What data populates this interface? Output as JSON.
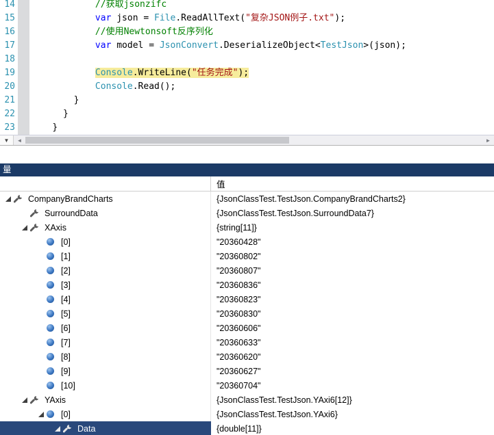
{
  "editor": {
    "lines": [
      {
        "num": "14",
        "indent": 12,
        "highlight": false,
        "tokens": [
          [
            "comment",
            "//获取jsonzifc"
          ]
        ]
      },
      {
        "num": "15",
        "indent": 12,
        "highlight": false,
        "tokens": [
          [
            "kw",
            "var"
          ],
          [
            "plain",
            " json = "
          ],
          [
            "type",
            "File"
          ],
          [
            "plain",
            ".ReadAllText("
          ],
          [
            "str",
            "\"复杂JSON例子.txt\""
          ],
          [
            "plain",
            ");"
          ]
        ]
      },
      {
        "num": "16",
        "indent": 12,
        "highlight": false,
        "tokens": [
          [
            "comment",
            "//使用Newtonsoft反序列化"
          ]
        ]
      },
      {
        "num": "17",
        "indent": 12,
        "highlight": false,
        "tokens": [
          [
            "kw",
            "var"
          ],
          [
            "plain",
            " model = "
          ],
          [
            "type",
            "JsonConvert"
          ],
          [
            "plain",
            ".DeserializeObject<"
          ],
          [
            "type",
            "TestJson"
          ],
          [
            "plain",
            ">(json);"
          ]
        ]
      },
      {
        "num": "18",
        "indent": 0,
        "highlight": false,
        "tokens": []
      },
      {
        "num": "19",
        "indent": 12,
        "highlight": true,
        "tokens": [
          [
            "type",
            "Console"
          ],
          [
            "plain",
            ".WriteLine("
          ],
          [
            "str",
            "\"任务完成\""
          ],
          [
            "plain",
            ");"
          ]
        ]
      },
      {
        "num": "20",
        "indent": 12,
        "highlight": false,
        "tokens": [
          [
            "type",
            "Console"
          ],
          [
            "plain",
            ".Read();"
          ]
        ]
      },
      {
        "num": "21",
        "indent": 8,
        "highlight": false,
        "tokens": [
          [
            "plain",
            "}"
          ]
        ]
      },
      {
        "num": "22",
        "indent": 6,
        "highlight": false,
        "tokens": [
          [
            "plain",
            "}"
          ]
        ]
      },
      {
        "num": "23",
        "indent": 4,
        "highlight": false,
        "tokens": [
          [
            "plain",
            "}"
          ]
        ]
      }
    ]
  },
  "scrollbar": {
    "dropdown_icon": "▼",
    "left_arrow": "◄",
    "right_arrow": "►"
  },
  "icons": {
    "property": "wrench-icon",
    "field": "blue-sphere-field-icon",
    "expanded": "triangle-expanded-icon",
    "collapsed": "triangle-collapsed-icon"
  },
  "locals_panel": {
    "title": "量",
    "columns": {
      "name": "",
      "value": "值"
    },
    "rows": [
      {
        "level": 0,
        "expander": "expanded",
        "icon": "property",
        "name": "CompanyBrandCharts",
        "value": "{JsonClassTest.TestJson.CompanyBrandCharts2}",
        "selected": false
      },
      {
        "level": 1,
        "expander": "none",
        "icon": "property",
        "name": "SurroundData",
        "value": "{JsonClassTest.TestJson.SurroundData7}",
        "selected": false
      },
      {
        "level": 1,
        "expander": "expanded",
        "icon": "property",
        "name": "XAxis",
        "value": "{string[11]}",
        "selected": false
      },
      {
        "level": 2,
        "expander": "none",
        "icon": "field",
        "name": "[0]",
        "value": "\"20360428\"",
        "selected": false
      },
      {
        "level": 2,
        "expander": "none",
        "icon": "field",
        "name": "[1]",
        "value": "\"20360802\"",
        "selected": false
      },
      {
        "level": 2,
        "expander": "none",
        "icon": "field",
        "name": "[2]",
        "value": "\"20360807\"",
        "selected": false
      },
      {
        "level": 2,
        "expander": "none",
        "icon": "field",
        "name": "[3]",
        "value": "\"20360836\"",
        "selected": false
      },
      {
        "level": 2,
        "expander": "none",
        "icon": "field",
        "name": "[4]",
        "value": "\"20360823\"",
        "selected": false
      },
      {
        "level": 2,
        "expander": "none",
        "icon": "field",
        "name": "[5]",
        "value": "\"20360830\"",
        "selected": false
      },
      {
        "level": 2,
        "expander": "none",
        "icon": "field",
        "name": "[6]",
        "value": "\"20360606\"",
        "selected": false
      },
      {
        "level": 2,
        "expander": "none",
        "icon": "field",
        "name": "[7]",
        "value": "\"20360633\"",
        "selected": false
      },
      {
        "level": 2,
        "expander": "none",
        "icon": "field",
        "name": "[8]",
        "value": "\"20360620\"",
        "selected": false
      },
      {
        "level": 2,
        "expander": "none",
        "icon": "field",
        "name": "[9]",
        "value": "\"20360627\"",
        "selected": false
      },
      {
        "level": 2,
        "expander": "none",
        "icon": "field",
        "name": "[10]",
        "value": "\"20360704\"",
        "selected": false
      },
      {
        "level": 1,
        "expander": "expanded",
        "icon": "property",
        "name": "YAxis",
        "value": "{JsonClassTest.TestJson.YAxi6[12]}",
        "selected": false
      },
      {
        "level": 2,
        "expander": "expanded",
        "icon": "field",
        "name": "[0]",
        "value": "{JsonClassTest.TestJson.YAxi6}",
        "selected": false
      },
      {
        "level": 3,
        "expander": "expanded",
        "icon": "property",
        "name": "Data",
        "value": "{double[11]}",
        "selected": true
      }
    ]
  }
}
